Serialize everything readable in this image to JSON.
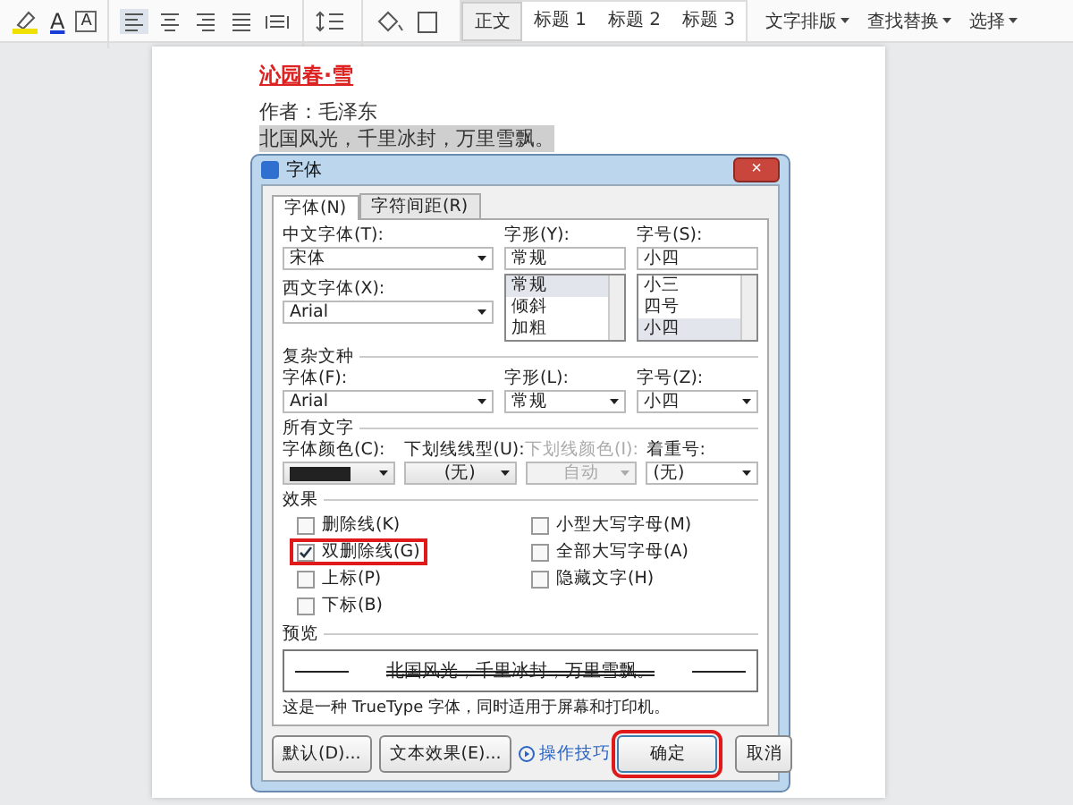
{
  "toolbar": {
    "font_color_glyph": "A",
    "text_box_glyph": "A",
    "styles": [
      {
        "label": "正文",
        "selected": true
      },
      {
        "label": "标题 1",
        "selected": false
      },
      {
        "label": "标题 2",
        "selected": false
      },
      {
        "label": "标题 3",
        "selected": false
      }
    ],
    "menus": [
      "文字排版",
      "查找替换",
      "选择"
    ]
  },
  "document": {
    "title": "沁园春·雪",
    "lines": [
      {
        "text": "作者：毛泽东",
        "highlighted": false
      },
      {
        "text": "北国风光，千里冰封，万里雪飘。",
        "highlighted": true
      }
    ]
  },
  "dialog": {
    "title": "字体",
    "close": "×",
    "tabs": [
      {
        "label": "字体(N)",
        "selected": true
      },
      {
        "label": "字符间距(R)",
        "selected": false
      }
    ],
    "chinese_font": {
      "label": "中文字体(T):",
      "value": "宋体"
    },
    "font_style": {
      "label": "字形(Y):",
      "value": "常规",
      "options": [
        {
          "label": "常规",
          "selected": true
        },
        {
          "label": "倾斜",
          "selected": false
        },
        {
          "label": "加粗",
          "selected": false
        }
      ]
    },
    "font_size": {
      "label": "字号(S):",
      "value": "小四",
      "options": [
        {
          "label": "小三",
          "selected": false
        },
        {
          "label": "四号",
          "selected": false
        },
        {
          "label": "小四",
          "selected": true
        }
      ]
    },
    "western_font": {
      "label": "西文字体(X):",
      "value": "Arial"
    },
    "complex": {
      "heading": "复杂文种",
      "font": {
        "label": "字体(F):",
        "value": "Arial"
      },
      "style": {
        "label": "字形(L):",
        "value": "常规"
      },
      "size": {
        "label": "字号(Z):",
        "value": "小四"
      }
    },
    "all_text": {
      "heading": "所有文字",
      "font_color": {
        "label": "字体颜色(C):",
        "color": "#222222"
      },
      "underline_type": {
        "label": "下划线线型(U):",
        "value": "(无)",
        "disabled": false
      },
      "underline_color": {
        "label": "下划线颜色(I):",
        "value": "自动",
        "disabled": true
      },
      "emphasis": {
        "label": "着重号:",
        "value": "(无)"
      }
    },
    "effects": {
      "heading": "效果",
      "items": [
        {
          "label": "删除线(K)",
          "checked": false,
          "highlighted": false
        },
        {
          "label": "双删除线(G)",
          "checked": true,
          "highlighted": true
        },
        {
          "label": "上标(P)",
          "checked": false,
          "highlighted": false
        },
        {
          "label": "下标(B)",
          "checked": false,
          "highlighted": false
        },
        {
          "label": "小型大写字母(M)",
          "checked": false,
          "highlighted": false
        },
        {
          "label": "全部大写字母(A)",
          "checked": false,
          "highlighted": false
        },
        {
          "label": "隐藏文字(H)",
          "checked": false,
          "highlighted": false
        }
      ]
    },
    "preview": {
      "heading": "预览",
      "text": "北国风光，千里冰封，万里雪飘。",
      "double_strike": true
    },
    "note": "这是一种 TrueType 字体，同时适用于屏幕和打印机。",
    "buttons": [
      {
        "label": "默认(D)...",
        "kind": "button",
        "highlighted": false
      },
      {
        "label": "文本效果(E)...",
        "kind": "button",
        "highlighted": false
      },
      {
        "label": "操作技巧",
        "kind": "link",
        "highlighted": false
      },
      {
        "label": "确定",
        "kind": "primary",
        "highlighted": true
      },
      {
        "label": "取消",
        "kind": "button",
        "highlighted": false
      }
    ]
  }
}
